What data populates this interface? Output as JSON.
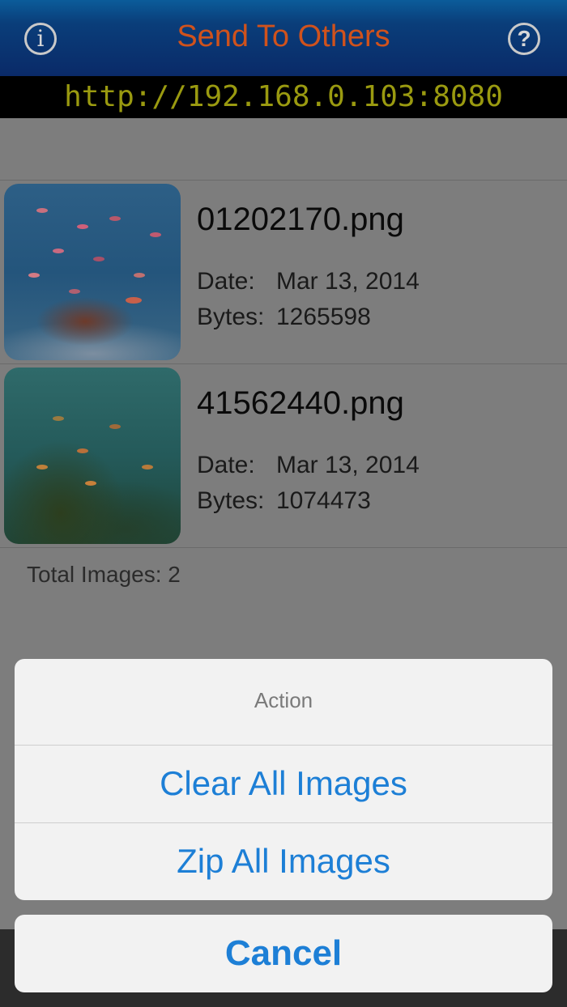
{
  "navbar": {
    "title": "Send To Others",
    "info_icon_glyph": "i",
    "help_icon_glyph": "?"
  },
  "server_url": "http://192.168.0.103:8080",
  "images": [
    {
      "name": "01202170.png",
      "date_label": "Date:",
      "date": "Mar 13, 2014",
      "bytes_label": "Bytes:",
      "bytes": "1265598"
    },
    {
      "name": "41562440.png",
      "date_label": "Date:",
      "date": "Mar 13, 2014",
      "bytes_label": "Bytes:",
      "bytes": "1074473"
    }
  ],
  "total_images": "Total Images: 2",
  "action_sheet": {
    "title": "Action",
    "buttons": [
      "Clear All Images",
      "Zip All Images"
    ],
    "cancel": "Cancel",
    "button_color": "#1d7fd6"
  },
  "icons": [
    "info-icon",
    "help-icon"
  ]
}
